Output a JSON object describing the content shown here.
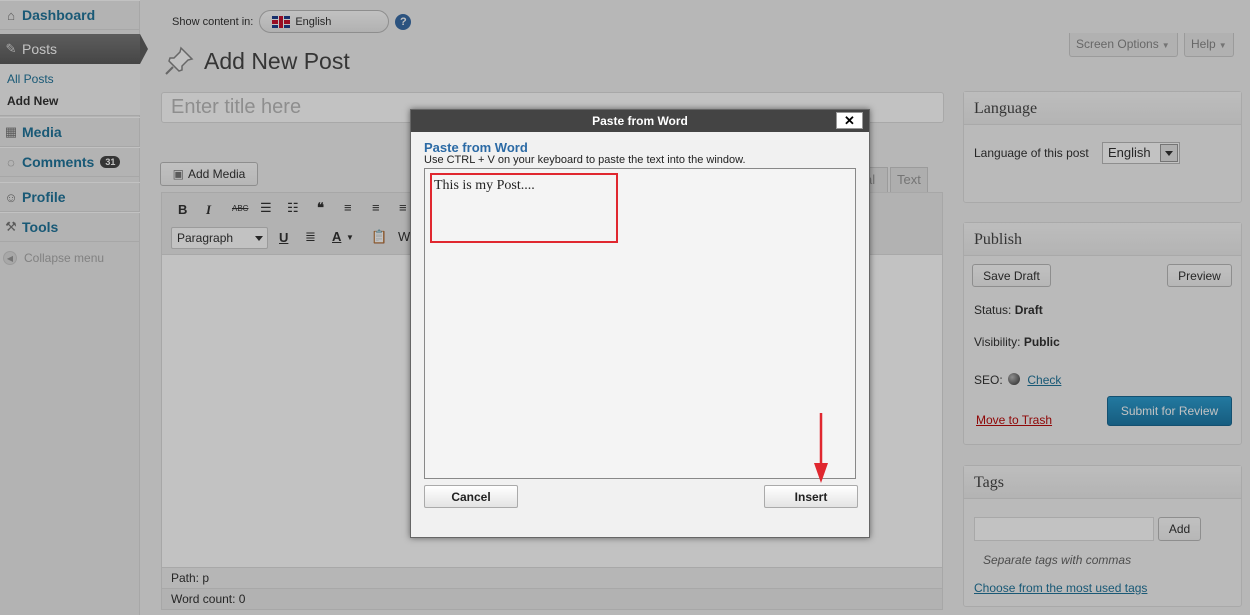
{
  "menu": {
    "dashboard": "Dashboard",
    "posts": "Posts",
    "all_posts": "All Posts",
    "add_new": "Add New",
    "media": "Media",
    "comments": "Comments",
    "comments_count": "31",
    "profile": "Profile",
    "tools": "Tools",
    "collapse": "Collapse menu"
  },
  "lang_bar": {
    "label": "Show content in:",
    "language": "English",
    "help": "?"
  },
  "screen_options": "Screen Options",
  "help_tab": "Help",
  "page_title": "Add New Post",
  "title_placeholder": "Enter title here",
  "add_media": "Add Media",
  "editor": {
    "tab_visual_fragment": "al",
    "tab_text": "Text",
    "format": "Paragraph",
    "path": "Path: p",
    "word_count": "Word count: 0"
  },
  "language_box": {
    "title": "Language",
    "label": "Language of this post",
    "value": "English"
  },
  "publish": {
    "title": "Publish",
    "save_draft": "Save Draft",
    "preview": "Preview",
    "status_label": "Status:",
    "status_value": "Draft",
    "visibility_label": "Visibility:",
    "visibility_value": "Public",
    "seo_label": "SEO:",
    "seo_link": "Check",
    "trash": "Move to Trash",
    "submit": "Submit for Review"
  },
  "tags": {
    "title": "Tags",
    "add": "Add",
    "hint": "Separate tags with commas",
    "choose": "Choose from the most used tags"
  },
  "dialog": {
    "title": "Paste from Word",
    "close": "✕",
    "heading": "Paste from Word",
    "instructions": "Use CTRL + V on your keyboard to paste the text into the window.",
    "content": "This is my Post....",
    "cancel": "Cancel",
    "insert": "Insert"
  },
  "colors": {
    "link": "#21759b",
    "primary_button": "#2e9fd2",
    "annotation": "#e0272f"
  }
}
